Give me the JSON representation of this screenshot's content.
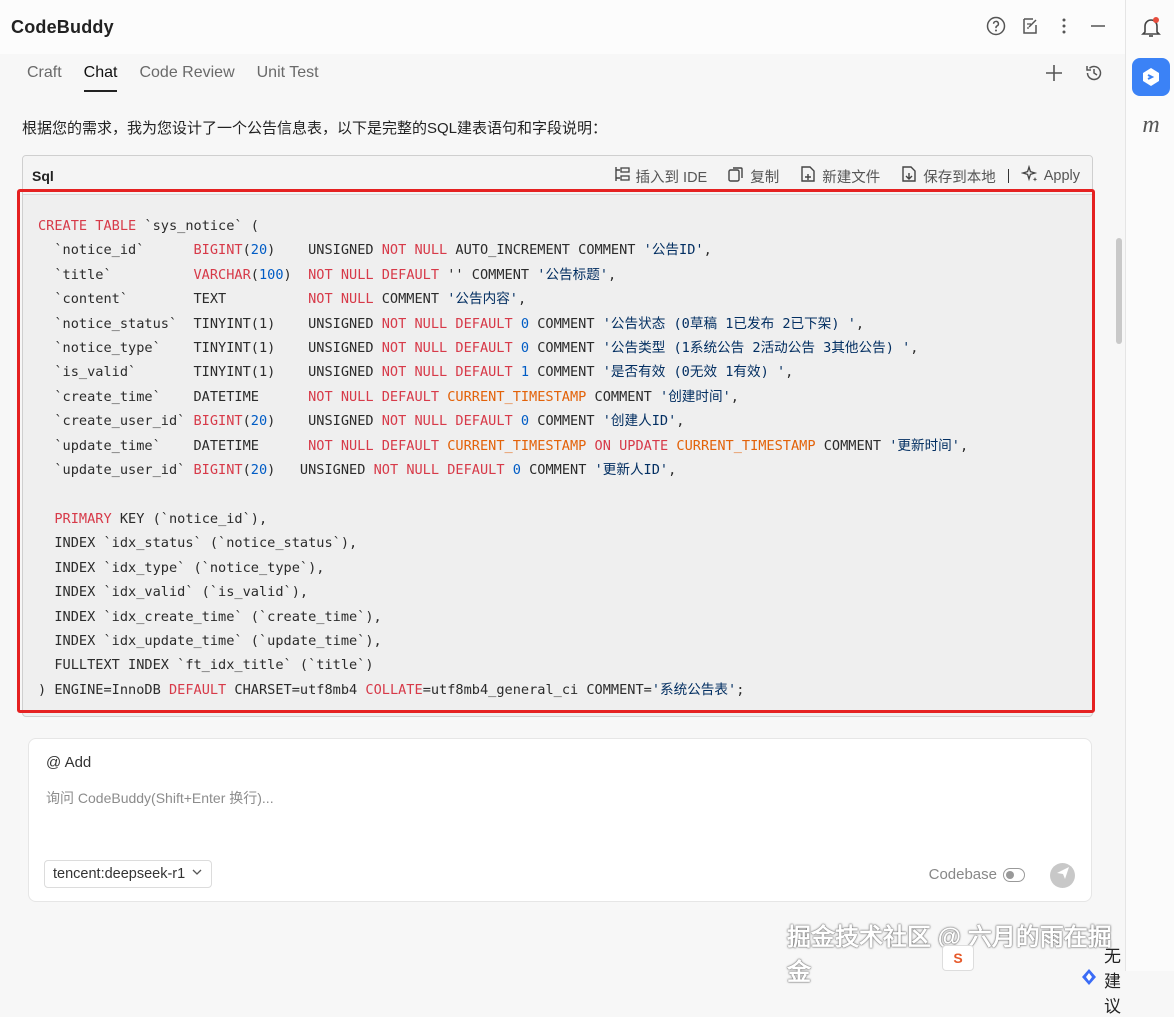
{
  "window": {
    "title": "CodeBuddy",
    "icons": [
      "help-icon",
      "edit-icon",
      "more-icon",
      "minimize-icon"
    ]
  },
  "tabs": [
    {
      "label": "Craft",
      "active": false
    },
    {
      "label": "Chat",
      "active": true
    },
    {
      "label": "Code Review",
      "active": false
    },
    {
      "label": "Unit Test",
      "active": false
    }
  ],
  "tab_actions": [
    "plus-icon",
    "history-icon"
  ],
  "intro_text": "根据您的需求，我为您设计了一个公告信息表，以下是完整的SQL建表语句和字段说明：",
  "code_card": {
    "language": "Sql",
    "actions": {
      "insert": "插入到 IDE",
      "copy": "复制",
      "new_file": "新建文件",
      "save": "保存到本地",
      "apply": "Apply"
    },
    "lines": [
      [
        [
          "kw",
          "CREATE TABLE"
        ],
        [
          "p",
          " `sys_notice` ("
        ]
      ],
      [
        [
          "p",
          "  `notice_id`      "
        ],
        [
          "kw",
          "BIGINT"
        ],
        [
          "p",
          "("
        ],
        [
          "num",
          "20"
        ],
        [
          "p",
          ")    UNSIGNED "
        ],
        [
          "kw",
          "NOT NULL"
        ],
        [
          "p",
          " AUTO_INCREMENT COMMENT "
        ],
        [
          "str",
          "'公告ID'"
        ],
        [
          "p",
          ","
        ]
      ],
      [
        [
          "p",
          "  `title`          "
        ],
        [
          "kw",
          "VARCHAR"
        ],
        [
          "p",
          "("
        ],
        [
          "num",
          "100"
        ],
        [
          "p",
          ")  "
        ],
        [
          "kw",
          "NOT NULL DEFAULT"
        ],
        [
          "p",
          " '' COMMENT "
        ],
        [
          "str",
          "'公告标题'"
        ],
        [
          "p",
          ","
        ]
      ],
      [
        [
          "p",
          "  `content`        TEXT          "
        ],
        [
          "kw",
          "NOT NULL"
        ],
        [
          "p",
          " COMMENT "
        ],
        [
          "str",
          "'公告内容'"
        ],
        [
          "p",
          ","
        ]
      ],
      [
        [
          "p",
          "  `notice_status`  TINYINT(1)    UNSIGNED "
        ],
        [
          "kw",
          "NOT NULL DEFAULT"
        ],
        [
          "p",
          " "
        ],
        [
          "num",
          "0"
        ],
        [
          "p",
          " COMMENT "
        ],
        [
          "str",
          "'公告状态 (0草稿 1已发布 2已下架) '"
        ],
        [
          "p",
          ","
        ]
      ],
      [
        [
          "p",
          "  `notice_type`    TINYINT(1)    UNSIGNED "
        ],
        [
          "kw",
          "NOT NULL DEFAULT"
        ],
        [
          "p",
          " "
        ],
        [
          "num",
          "0"
        ],
        [
          "p",
          " COMMENT "
        ],
        [
          "str",
          "'公告类型 (1系统公告 2活动公告 3其他公告) '"
        ],
        [
          "p",
          ","
        ]
      ],
      [
        [
          "p",
          "  `is_valid`       TINYINT(1)    UNSIGNED "
        ],
        [
          "kw",
          "NOT NULL DEFAULT"
        ],
        [
          "p",
          " "
        ],
        [
          "num",
          "1"
        ],
        [
          "p",
          " COMMENT "
        ],
        [
          "str",
          "'是否有效 (0无效 1有效) '"
        ],
        [
          "p",
          ","
        ]
      ],
      [
        [
          "p",
          "  `create_time`    DATETIME      "
        ],
        [
          "kw",
          "NOT NULL DEFAULT"
        ],
        [
          "p",
          " "
        ],
        [
          "ts",
          "CURRENT_TIMESTAMP"
        ],
        [
          "p",
          " COMMENT "
        ],
        [
          "str",
          "'创建时间'"
        ],
        [
          "p",
          ","
        ]
      ],
      [
        [
          "p",
          "  `create_user_id` "
        ],
        [
          "kw",
          "BIGINT"
        ],
        [
          "p",
          "("
        ],
        [
          "num",
          "20"
        ],
        [
          "p",
          ")    UNSIGNED "
        ],
        [
          "kw",
          "NOT NULL DEFAULT"
        ],
        [
          "p",
          " "
        ],
        [
          "num",
          "0"
        ],
        [
          "p",
          " COMMENT "
        ],
        [
          "str",
          "'创建人ID'"
        ],
        [
          "p",
          ","
        ]
      ],
      [
        [
          "p",
          "  `update_time`    DATETIME      "
        ],
        [
          "kw",
          "NOT NULL DEFAULT"
        ],
        [
          "p",
          " "
        ],
        [
          "ts",
          "CURRENT_TIMESTAMP"
        ],
        [
          "p",
          " "
        ],
        [
          "kw",
          "ON UPDATE"
        ],
        [
          "p",
          " "
        ],
        [
          "ts",
          "CURRENT_TIMESTAMP"
        ],
        [
          "p",
          " COMMENT "
        ],
        [
          "str",
          "'更新时间'"
        ],
        [
          "p",
          ","
        ]
      ],
      [
        [
          "p",
          "  `update_user_id` "
        ],
        [
          "kw",
          "BIGINT"
        ],
        [
          "p",
          "("
        ],
        [
          "num",
          "20"
        ],
        [
          "p",
          ")   UNSIGNED "
        ],
        [
          "kw",
          "NOT NULL DEFAULT"
        ],
        [
          "p",
          " "
        ],
        [
          "num",
          "0"
        ],
        [
          "p",
          " COMMENT "
        ],
        [
          "str",
          "'更新人ID'"
        ],
        [
          "p",
          ","
        ]
      ],
      [
        [
          "p",
          ""
        ]
      ],
      [
        [
          "p",
          "  "
        ],
        [
          "kw",
          "PRIMARY"
        ],
        [
          "p",
          " KEY (`notice_id`),"
        ]
      ],
      [
        [
          "p",
          "  INDEX `idx_status` (`notice_status`),"
        ]
      ],
      [
        [
          "p",
          "  INDEX `idx_type` (`notice_type`),"
        ]
      ],
      [
        [
          "p",
          "  INDEX `idx_valid` (`is_valid`),"
        ]
      ],
      [
        [
          "p",
          "  INDEX `idx_create_time` (`create_time`),"
        ]
      ],
      [
        [
          "p",
          "  INDEX `idx_update_time` (`update_time`),"
        ]
      ],
      [
        [
          "p",
          "  FULLTEXT INDEX `ft_idx_title` (`title`)"
        ]
      ],
      [
        [
          "p",
          ") ENGINE=InnoDB "
        ],
        [
          "kw",
          "DEFAULT"
        ],
        [
          "p",
          " CHARSET=utf8mb4 "
        ],
        [
          "kw",
          "COLLATE"
        ],
        [
          "p",
          "=utf8mb4_general_ci COMMENT="
        ],
        [
          "str",
          "'系统公告表'"
        ],
        [
          "p",
          ";"
        ]
      ]
    ]
  },
  "composer": {
    "add_label": "@ Add",
    "placeholder": "询问 CodeBuddy(Shift+Enter 换行)...",
    "model": "tencent:deepseek-r1",
    "codebase_label": "Codebase",
    "codebase_enabled": false
  },
  "watermark": "掘金技术社区 @ 六月的雨在掘金",
  "suggest_label": "无建议",
  "badge_label": "S",
  "right_rail": [
    "bell-icon",
    "codebuddy-logo-icon",
    "m-icon"
  ]
}
